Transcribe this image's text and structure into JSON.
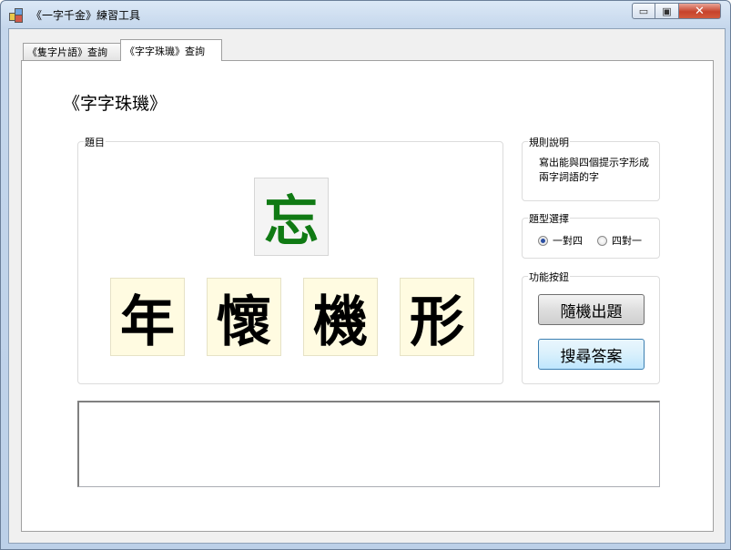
{
  "window": {
    "title": "《一字千金》練習工具",
    "minimize_glyph": "▭",
    "maximize_glyph": "▣",
    "close_glyph": "✕",
    "app_icon": "app-window-icon"
  },
  "tabs": [
    {
      "label": "《隻字片語》查詢",
      "selected": false
    },
    {
      "label": "《字字珠璣》查詢",
      "selected": true
    }
  ],
  "page": {
    "heading": "《字字珠璣》",
    "question_group": {
      "label": "題目",
      "target_char": "忘",
      "target_color": "#107a14",
      "hint_chars": [
        "年",
        "懷",
        "機",
        "形"
      ]
    },
    "rules_group": {
      "label": "規則說明",
      "text": "寫出能與四個提示字形成兩字詞語的字"
    },
    "type_group": {
      "label": "題型選擇",
      "options": [
        {
          "label": "一對四",
          "checked": true
        },
        {
          "label": "四對一",
          "checked": false
        }
      ]
    },
    "function_group": {
      "label": "功能按鈕",
      "random_button": "隨機出題",
      "search_button": "搜尋答案"
    },
    "output_text": ""
  }
}
